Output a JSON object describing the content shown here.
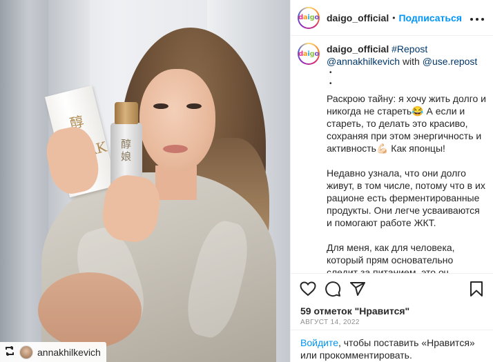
{
  "header": {
    "username": "daigo_official",
    "separator": "•",
    "follow_label": "Подписаться",
    "more_label": "•••",
    "logo_letters": [
      "d",
      "a",
      "i",
      "g",
      "o"
    ]
  },
  "photo": {
    "box_text": "醇 娘\nSAK",
    "bottle_text": "醇\n娘",
    "repost_user": "annakhilkevich",
    "repost_icon": "repost-icon"
  },
  "caption": {
    "username": "daigo_official",
    "hashtag": "#Repost",
    "mention": "@annakhilkevich",
    "with_text": "with",
    "mention2": "@use.repost",
    "dots": "•\n•",
    "paragraphs": [
      "Раскрою тайну: я хочу жить долго и никогда не стареть😂 А если и стареть, то делать это красиво, сохраняя при этом энергичность и активность💪🏻 Как японцы!",
      "Недавно узнала, что они долго живут, в том числе, потому что в их рационе есть ферментированные продукты. Они легче усваиваются и помогают работе ЖКТ.",
      "Для меня, как для человека, который прям основательно следит за питанием, это оч интересная тема. Я начала изучать ее глубже"
    ]
  },
  "actions": {
    "icons": [
      "heart-icon",
      "comment-icon",
      "share-icon",
      "bookmark-icon"
    ]
  },
  "likes": "59 отметок \"Нравится\"",
  "date": "АВГУСТ 14, 2022",
  "login": {
    "link": "Войдите",
    "text": ", чтобы поставить «Нравится» или прокомментировать."
  },
  "colors": {
    "accent": "#0095f6",
    "text": "#262626",
    "muted": "#8e8e8e",
    "link_dark": "#00376b"
  }
}
